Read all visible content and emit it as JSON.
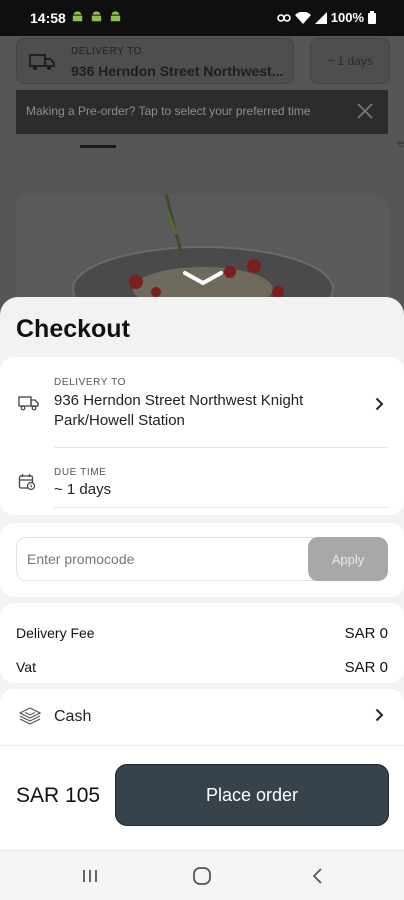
{
  "status_bar": {
    "time": "14:58",
    "battery": "100%"
  },
  "background": {
    "delivery_label": "DELIVERY TO",
    "delivery_address": "936 Herndon Street Northwest...",
    "due": "~ 1 days",
    "preorder_banner": "Making a Pre-order? Tap to select your preferred time",
    "side_text": "es"
  },
  "checkout": {
    "title": "Checkout",
    "delivery": {
      "label": "DELIVERY TO",
      "address": "936 Herndon Street Northwest Knight Park/Howell Station"
    },
    "due_time": {
      "label": "DUE TIME",
      "value": "~ 1 days"
    },
    "promo": {
      "placeholder": "Enter promocode",
      "apply_label": "Apply"
    },
    "fees": [
      {
        "label": "Delivery Fee",
        "value": "SAR 0"
      },
      {
        "label": "Vat",
        "value": "SAR 0"
      }
    ],
    "payment": {
      "method": "Cash"
    },
    "total": "SAR 105",
    "place_order_label": "Place order"
  },
  "colors": {
    "primary_button": "#37424a",
    "apply_disabled": "#a7a8a8"
  },
  "icons": [
    "truck-icon",
    "calendar-clock-icon",
    "cash-icon",
    "chevron-right-icon",
    "chevron-down-icon",
    "close-icon",
    "recents-icon",
    "home-icon",
    "back-icon"
  ]
}
